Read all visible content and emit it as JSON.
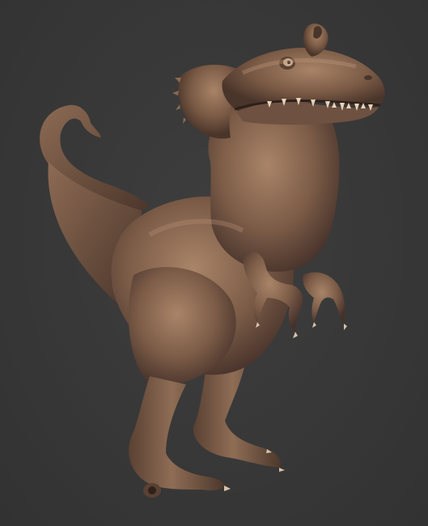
{
  "scene": {
    "subject": "sculpted-dinosaur-model",
    "colors": {
      "background": "#3a3a3a",
      "clay": "#7a5a45",
      "clay_light": "#a98468",
      "clay_dark": "#3f2c22"
    }
  }
}
